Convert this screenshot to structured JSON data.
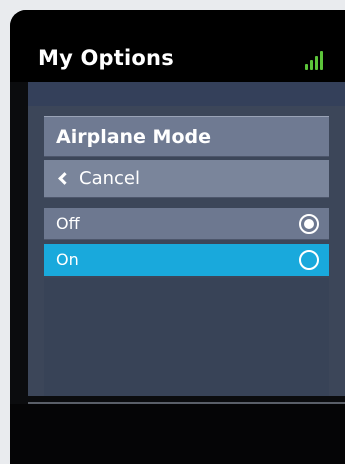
{
  "header": {
    "title": "My Options",
    "signal_icon": "signal-bars-icon",
    "signal_color": "#5cc53a"
  },
  "menu": {
    "title": "Airplane Mode",
    "cancel_label": "Cancel",
    "back_icon": "chevron-left-icon",
    "options": [
      {
        "label": "Off",
        "selected": true
      },
      {
        "label": "On",
        "selected": false
      }
    ]
  },
  "colors": {
    "highlight": "#19a9dc",
    "menu_background": "#3c4659"
  }
}
